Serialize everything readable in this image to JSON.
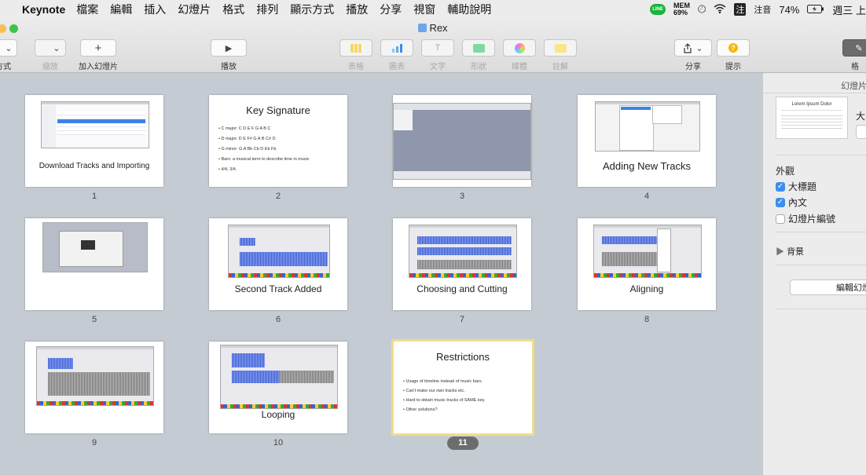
{
  "menubar": {
    "app": "Keynote",
    "items": [
      "檔案",
      "編輯",
      "插入",
      "幻燈片",
      "格式",
      "排列",
      "顯示方式",
      "播放",
      "分享",
      "視窗",
      "輔助說明"
    ],
    "line_badge": "LINE",
    "mem_label": "MEM",
    "mem_value": "69%",
    "input_method_badge": "注",
    "input_method": "注音",
    "battery": "74%",
    "clock": "週三 上"
  },
  "window": {
    "title": "Rex"
  },
  "toolbar": {
    "view_label": "方式",
    "zoom_label": "縮放",
    "add_slide_label": "加入幻燈片",
    "play_label": "播放",
    "table_label": "表格",
    "chart_label": "圖表",
    "text_label": "文字",
    "shape_label": "形狀",
    "media_label": "媒體",
    "comment_label": "註解",
    "share_label": "分享",
    "tips_label": "提示",
    "format_label": "格"
  },
  "slides": [
    {
      "number": "1",
      "title": "Download Tracks and Importing",
      "kind": "titled-screenshot"
    },
    {
      "number": "2",
      "title": "Key Signature",
      "kind": "bullets",
      "bullets": [
        "C major: C D E F G A B C",
        "D major: D E F# G A B C# D",
        "G minor: G A Bb Cb D Eb Fb",
        "Bars: a musical term to describe time in music",
        "4/4, 3/4."
      ]
    },
    {
      "number": "3",
      "title": "",
      "kind": "screenshot"
    },
    {
      "number": "4",
      "title": "Adding New Tracks",
      "kind": "titled-screenshot"
    },
    {
      "number": "5",
      "title": "",
      "kind": "screenshot"
    },
    {
      "number": "6",
      "title": "Second Track Added",
      "kind": "titled-screenshot"
    },
    {
      "number": "7",
      "title": "Choosing and Cutting",
      "kind": "titled-screenshot"
    },
    {
      "number": "8",
      "title": "Aligning",
      "kind": "titled-screenshot"
    },
    {
      "number": "9",
      "title": "",
      "kind": "screenshot"
    },
    {
      "number": "10",
      "title": "Looping",
      "kind": "titled-screenshot"
    },
    {
      "number": "11",
      "title": "Restrictions",
      "kind": "bullets",
      "selected": true,
      "bullets": [
        "Usage of timeline instead of music bars.",
        "Can't make our own tracks etc.",
        "Hard to obtain music tracks of SAME key.",
        "Other solutions?"
      ]
    }
  ],
  "inspector": {
    "tab_label": "幻燈片",
    "thumb_title": "Lorem Ipsum Dolor",
    "layout_name": "大",
    "appearance_label": "外觀",
    "title_checkbox": "大標題",
    "body_checkbox": "內文",
    "slide_number_checkbox": "幻燈片編號",
    "background_label": "背景",
    "edit_button": "編輯幻燈"
  },
  "colors": {
    "selection": "#f2dc8a",
    "checkbox": "#3b8ef0",
    "canvas": "#c4cbd3"
  }
}
